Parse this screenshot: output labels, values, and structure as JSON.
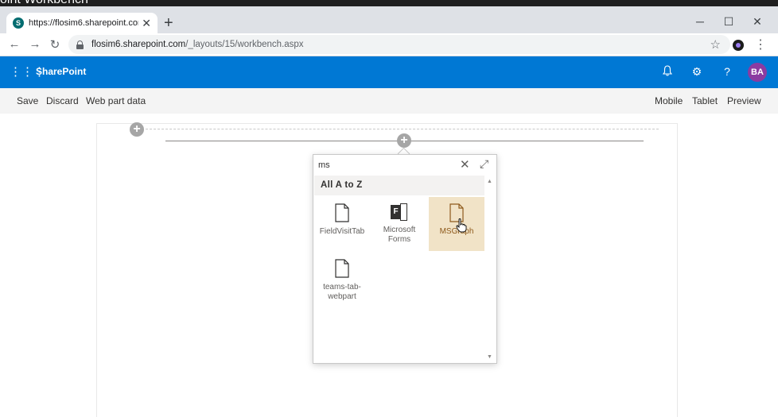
{
  "window": {
    "title": "oint Workbench"
  },
  "browser": {
    "tab_title": "https://flosim6.sharepoint.com/_l",
    "favicon_letter": "S",
    "url_host": "flosim6.sharepoint.com",
    "url_path": "/_layouts/15/workbench.aspx"
  },
  "suitebar": {
    "brand": "SharePoint",
    "avatar_initials": "BA",
    "accent": "#0078d4"
  },
  "commandbar": {
    "left": [
      "Save",
      "Discard",
      "Web part data"
    ],
    "right": [
      "Mobile",
      "Tablet",
      "Preview"
    ]
  },
  "toolbox": {
    "search_value": "ms",
    "section_title": "All A to Z",
    "tiles": [
      {
        "label": "FieldVisitTab",
        "icon": "document-icon"
      },
      {
        "label": "Microsoft\nForms",
        "icon": "forms-icon"
      },
      {
        "label": "MSGraph",
        "icon": "document-icon",
        "selected": true
      },
      {
        "label": "teams-tab-\nwebpart",
        "icon": "document-icon"
      }
    ]
  }
}
